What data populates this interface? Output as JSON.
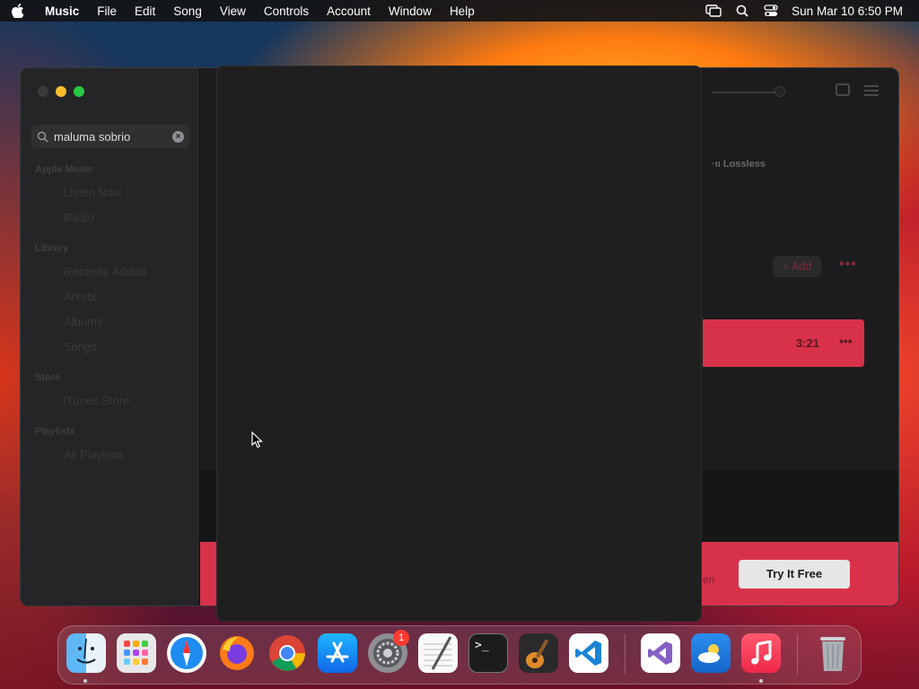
{
  "menubar": {
    "app_name": "Music",
    "menus": [
      "File",
      "Edit",
      "Song",
      "View",
      "Controls",
      "Account",
      "Window",
      "Help"
    ],
    "datetime": "Sun Mar 10  6:50 PM"
  },
  "sidebar": {
    "search_value": "maluma sobrio",
    "sections": [
      {
        "title": "Apple Music",
        "items": [
          "Listen Now",
          "Radio"
        ]
      },
      {
        "title": "Library",
        "items": [
          "Recently Added",
          "Artists",
          "Albums",
          "Songs"
        ]
      },
      {
        "title": "Store",
        "items": [
          "iTunes Store"
        ]
      },
      {
        "title": "Playlists",
        "items": [
          "All Playlists"
        ]
      }
    ]
  },
  "content": {
    "lossless_label": "Lossless",
    "add_label": "+ Add",
    "song_duration": "3:21",
    "promo_text": "en",
    "try_button": "Try It Free"
  },
  "dock": {
    "apps": [
      "finder-icon",
      "launchpad-icon",
      "safari-icon",
      "firefox-icon",
      "chrome-icon",
      "app-store-icon",
      "system-preferences-icon",
      "textedit-icon",
      "terminal-icon",
      "garageband-icon",
      "vscode-icon",
      "visual-studio-icon",
      "weather-icon",
      "music-icon",
      "trash-icon"
    ],
    "settings_badge": "1"
  },
  "colors": {
    "accent": "#d8324b",
    "traffic_min": "#ffbd2e",
    "traffic_max": "#28c840"
  }
}
